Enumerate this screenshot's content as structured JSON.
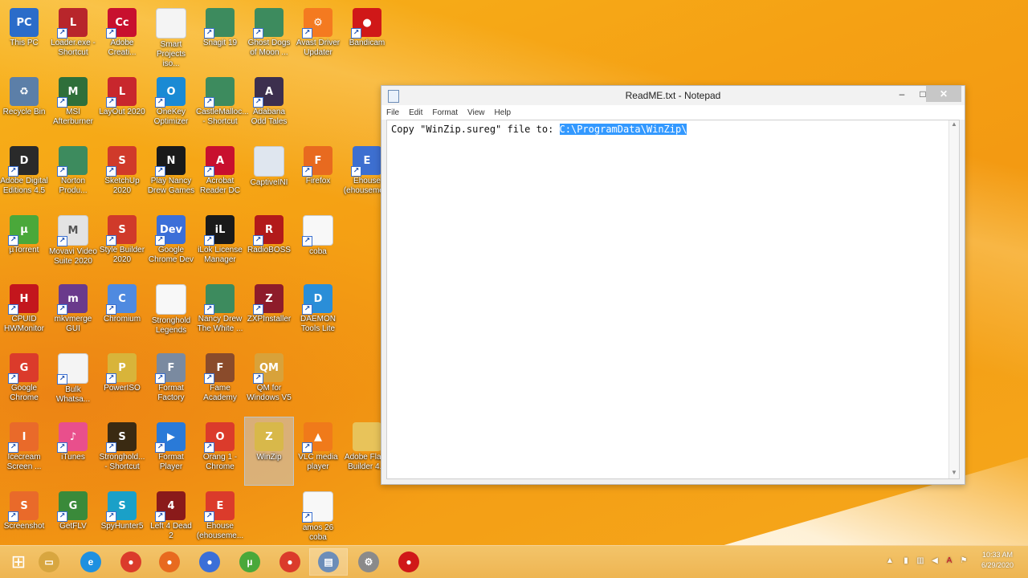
{
  "desktop": {
    "icons": [
      {
        "label": "This PC",
        "glyph": "PC",
        "color": "#2b6cc9",
        "shortcut": false
      },
      {
        "label": "Loader.exe -\nShortcut",
        "glyph": "L",
        "color": "#b8262b",
        "shortcut": true
      },
      {
        "label": "Adobe\nCreati...",
        "glyph": "Cc",
        "color": "#c8102e",
        "shortcut": true
      },
      {
        "label": "Smart\nProjects iso...",
        "glyph": "",
        "color": "#f4f4f4",
        "shortcut": false
      },
      {
        "label": "Snagit 19",
        "glyph": "",
        "color": "#3d8b5e",
        "shortcut": true
      },
      {
        "label": "Ghost Dogs\nof Moon ...",
        "glyph": "",
        "color": "#3d8b5e",
        "shortcut": true
      },
      {
        "label": "Avast Driver\nUpdater",
        "glyph": "⚙",
        "color": "#f47a20",
        "shortcut": true
      },
      {
        "label": "Bandicam",
        "glyph": "●",
        "color": "#d01818",
        "shortcut": true
      },
      {
        "label": "Recycle Bin",
        "glyph": "♻",
        "color": "#5c7fa8",
        "shortcut": false
      },
      {
        "label": "MSI\nAfterburner",
        "glyph": "M",
        "color": "#2f6f3a",
        "shortcut": true
      },
      {
        "label": "LayOut 2020",
        "glyph": "L",
        "color": "#c8272d",
        "shortcut": true
      },
      {
        "label": "OneKey\nOptimizer",
        "glyph": "O",
        "color": "#1a8ad4",
        "shortcut": true
      },
      {
        "label": "CastleMalloc...\n- Shortcut",
        "glyph": "",
        "color": "#3d8b5e",
        "shortcut": true
      },
      {
        "label": "Adabana\nOdd Tales",
        "glyph": "A",
        "color": "#3c2f4e",
        "shortcut": true
      },
      {
        "label": "Adobe Digital\nEditions 4.5",
        "glyph": "D",
        "color": "#2a2a2a",
        "shortcut": true
      },
      {
        "label": "Norton\nProdu...",
        "glyph": "",
        "color": "#3d8b5e",
        "shortcut": true
      },
      {
        "label": "SketchUp\n2020",
        "glyph": "S",
        "color": "#d03a2a",
        "shortcut": true
      },
      {
        "label": "Play Nancy\nDrew Games",
        "glyph": "N",
        "color": "#1a1a1a",
        "shortcut": true
      },
      {
        "label": "Acrobat\nReader DC",
        "glyph": "A",
        "color": "#c8102e",
        "shortcut": true
      },
      {
        "label": "CaptiveINI",
        "glyph": "",
        "color": "#dfe6ef",
        "shortcut": false
      },
      {
        "label": "Firefox",
        "glyph": "F",
        "color": "#e86a1f",
        "shortcut": true
      },
      {
        "label": "Ehouse\n(ehouseme...",
        "glyph": "E",
        "color": "#3d6fd0",
        "shortcut": true
      },
      {
        "label": "µTorrent",
        "glyph": "µ",
        "color": "#4aa83a",
        "shortcut": true
      },
      {
        "label": "Movavi Video\nSuite 2020",
        "glyph": "M",
        "color": "#e3e3e3",
        "shortcut": true
      },
      {
        "label": "Style Builder\n2020",
        "glyph": "S",
        "color": "#d03a2a",
        "shortcut": true
      },
      {
        "label": "Google\nChrome Dev",
        "glyph": "Dev",
        "color": "#3b6fd8",
        "shortcut": true
      },
      {
        "label": "iLok License\nManager",
        "glyph": "iL",
        "color": "#1a1a1a",
        "shortcut": true
      },
      {
        "label": "RadioBOSS",
        "glyph": "R",
        "color": "#b21a1a",
        "shortcut": true
      },
      {
        "label": "coba",
        "glyph": "",
        "color": "#f8f8f8",
        "shortcut": true
      },
      {
        "label": "CPUID\nHWMonitor",
        "glyph": "H",
        "color": "#c3161d",
        "shortcut": true
      },
      {
        "label": "mkvmerge\nGUI",
        "glyph": "m",
        "color": "#6a3a8c",
        "shortcut": true
      },
      {
        "label": "Chromium",
        "glyph": "C",
        "color": "#4f8ae0",
        "shortcut": true
      },
      {
        "label": "Stronghold\nLegends",
        "glyph": "",
        "color": "#f8f8f8",
        "shortcut": false
      },
      {
        "label": "Nancy Drew\nThe White ...",
        "glyph": "",
        "color": "#3d8b5e",
        "shortcut": true
      },
      {
        "label": "ZXPInstaller",
        "glyph": "Z",
        "color": "#8e1c2a",
        "shortcut": true
      },
      {
        "label": "DAEMON\nTools Lite",
        "glyph": "D",
        "color": "#2a8ed8",
        "shortcut": true
      },
      {
        "label": "Google\nChrome",
        "glyph": "G",
        "color": "#db3b2b",
        "shortcut": true
      },
      {
        "label": "Bulk\nWhatsa...",
        "glyph": "",
        "color": "#f4f4f4",
        "shortcut": true
      },
      {
        "label": "PowerISO",
        "glyph": "P",
        "color": "#d8b43a",
        "shortcut": true
      },
      {
        "label": "Format\nFactory",
        "glyph": "F",
        "color": "#7a8aa0",
        "shortcut": true
      },
      {
        "label": "Fame\nAcademy",
        "glyph": "F",
        "color": "#8a4b2b",
        "shortcut": true
      },
      {
        "label": "QM for\nWindows V5",
        "glyph": "QM",
        "color": "#d8a23a",
        "shortcut": true
      },
      {
        "label": "Icecream\nScreen ...",
        "glyph": "I",
        "color": "#e96a2a",
        "shortcut": true
      },
      {
        "label": "iTunes",
        "glyph": "♪",
        "color": "#e94f8c",
        "shortcut": true
      },
      {
        "label": "Stronghold...\n- Shortcut",
        "glyph": "S",
        "color": "#3a2a12",
        "shortcut": true
      },
      {
        "label": "Format\nPlayer",
        "glyph": "▶",
        "color": "#2a7ad8",
        "shortcut": true
      },
      {
        "label": "Orang 1 -\nChrome",
        "glyph": "O",
        "color": "#db3b2b",
        "shortcut": true
      },
      {
        "label": "WinZip",
        "glyph": "Z",
        "color": "#d8b84a",
        "shortcut": false
      },
      {
        "label": "VLC media\nplayer",
        "glyph": "▲",
        "color": "#f07a1a",
        "shortcut": true
      },
      {
        "label": "Adobe Flash\nBuilder 4.7",
        "glyph": "",
        "color": "#e8c35a",
        "shortcut": false
      },
      {
        "label": "Screenshot",
        "glyph": "S",
        "color": "#e96a2a",
        "shortcut": true
      },
      {
        "label": "GetFLV",
        "glyph": "G",
        "color": "#3a8a3a",
        "shortcut": true
      },
      {
        "label": "SpyHunter5",
        "glyph": "S",
        "color": "#1aa0c8",
        "shortcut": true
      },
      {
        "label": "Left 4 Dead 2",
        "glyph": "4",
        "color": "#8a1a1a",
        "shortcut": true
      },
      {
        "label": "Ehouse\n(ehouseme...",
        "glyph": "E",
        "color": "#db3b2b",
        "shortcut": true
      },
      {
        "label": "amos 26\ncoba",
        "glyph": "",
        "color": "#f8f8f8",
        "shortcut": true
      }
    ]
  },
  "notepad": {
    "title": "ReadME.txt - Notepad",
    "menu": [
      "File",
      "Edit",
      "Format",
      "View",
      "Help"
    ],
    "text_prefix": "Copy \"WinZip.sureg\" file to: ",
    "text_selected": "C:\\ProgramData\\WinZip\\",
    "minimize": "–",
    "maximize": "□",
    "close": "✕"
  },
  "taskbar": {
    "items": [
      {
        "name": "start-button",
        "glyph": "⊞",
        "color": "#ffffff"
      },
      {
        "name": "file-explorer",
        "glyph": "▭",
        "color": "#d8a640"
      },
      {
        "name": "internet-explorer",
        "glyph": "e",
        "color": "#1e90e0"
      },
      {
        "name": "chrome",
        "glyph": "●",
        "color": "#db3b2b"
      },
      {
        "name": "firefox",
        "glyph": "●",
        "color": "#e86a1f"
      },
      {
        "name": "chrome-dev",
        "glyph": "●",
        "color": "#3b6fd8"
      },
      {
        "name": "utorrent",
        "glyph": "µ",
        "color": "#4aa83a"
      },
      {
        "name": "chrome-ehouse",
        "glyph": "●",
        "color": "#db3b2b"
      },
      {
        "name": "notepad",
        "glyph": "▤",
        "color": "#6c8db8"
      },
      {
        "name": "settings",
        "glyph": "⚙",
        "color": "#8a8a8a"
      },
      {
        "name": "bandicam",
        "glyph": "●",
        "color": "#d01818"
      }
    ],
    "time": "10:33 AM",
    "date": "6/29/2020"
  }
}
